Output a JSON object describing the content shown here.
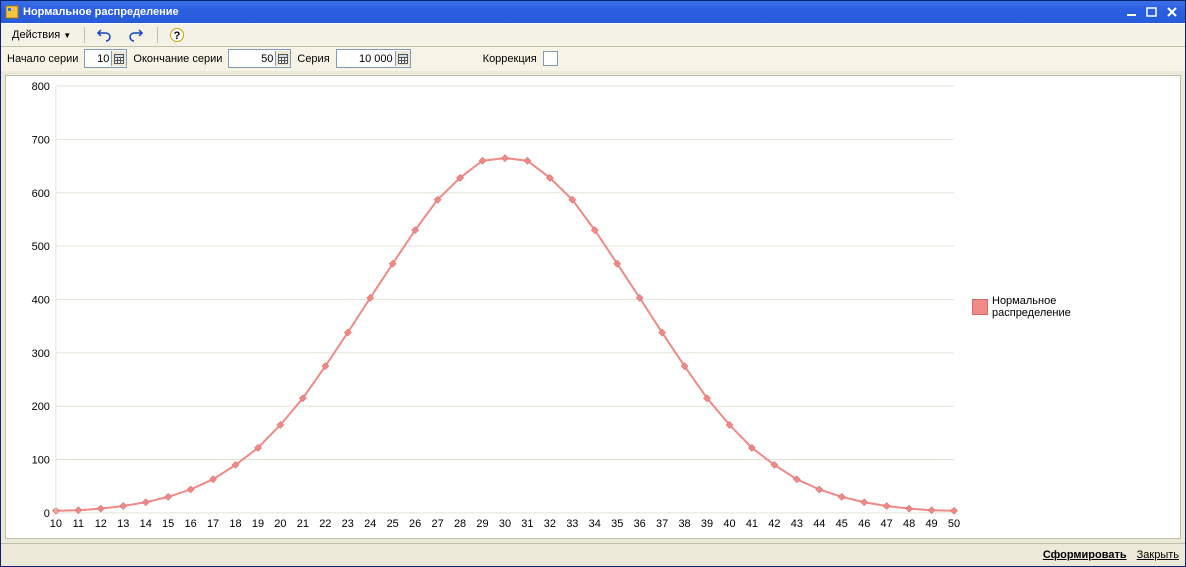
{
  "title": "Нормальное распределение",
  "toolbar": {
    "actions_label": "Действия"
  },
  "params": {
    "start_label": "Начало серии",
    "start_value": "10",
    "end_label": "Окончание серии",
    "end_value": "50",
    "series_label": "Серия",
    "series_value": "10 000",
    "correction_label": "Коррекция",
    "correction_checked": false
  },
  "legend": {
    "series_name": "Нормальное\nраспределение"
  },
  "footer": {
    "generate": "Сформировать",
    "close": "Закрыть"
  },
  "chart_data": {
    "type": "line",
    "title": "",
    "xlabel": "",
    "ylabel": "",
    "ylim": [
      0,
      800
    ],
    "y_ticks": [
      0,
      100,
      200,
      300,
      400,
      500,
      600,
      700,
      800
    ],
    "categories": [
      10,
      11,
      12,
      13,
      14,
      15,
      16,
      17,
      18,
      19,
      20,
      21,
      22,
      23,
      24,
      25,
      26,
      27,
      28,
      29,
      30,
      31,
      32,
      33,
      34,
      35,
      36,
      37,
      38,
      39,
      40,
      41,
      42,
      43,
      44,
      45,
      46,
      47,
      48,
      49,
      50
    ],
    "series": [
      {
        "name": "Нормальное распределение",
        "values": [
          4,
          5,
          8,
          13,
          20,
          30,
          44,
          63,
          90,
          122,
          165,
          215,
          275,
          338,
          403,
          467,
          530,
          587,
          628,
          660,
          665,
          660,
          628,
          587,
          530,
          467,
          403,
          338,
          275,
          215,
          165,
          122,
          90,
          63,
          44,
          30,
          20,
          13,
          8,
          5,
          4
        ]
      }
    ]
  }
}
